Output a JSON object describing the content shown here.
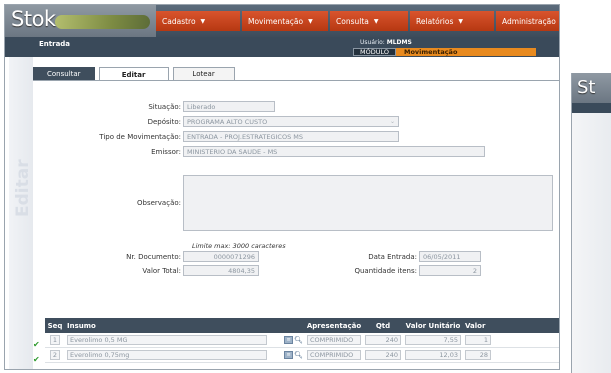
{
  "header": {
    "logo": "Stok",
    "menu": [
      "Cadastro",
      "Movimentação",
      "Consulta",
      "Relatórios",
      "Administração"
    ],
    "page_title": "Entrada",
    "user_label": "Usuário:",
    "user_name": "MLDMS",
    "modulo_label": "MÓDULO",
    "modulo_value": "Movimentação"
  },
  "watermark": "Editar",
  "tabs": [
    "Consultar",
    "Editar",
    "Lotear"
  ],
  "form": {
    "situacao_label": "Situação:",
    "situacao": "Liberado",
    "deposito_label": "Depósito:",
    "deposito": "PROGRAMA ALTO CUSTO",
    "tipo_label": "Tipo de Movimentação:",
    "tipo": "ENTRADA - PROJ.ESTRATEGICOS MS",
    "emissor_label": "Emissor:",
    "emissor": "MINISTERIO DA SAUDE - MS",
    "observacao_label": "Observação:",
    "observacao_hint": "Limite max: 3000 caracteres",
    "nr_documento_label": "Nr. Documento:",
    "nr_documento": "0000071296",
    "valor_total_label": "Valor Total:",
    "valor_total": "4804,35",
    "data_entrada_label": "Data Entrada:",
    "data_entrada": "06/05/2011",
    "quantidade_itens_label": "Quantidade itens:",
    "quantidade_itens": "2"
  },
  "grid": {
    "headers": [
      "Seq",
      "Insumo",
      "Apresentação",
      "Qtd",
      "Valor Unitário",
      "Valor"
    ],
    "rows": [
      {
        "seq": "1",
        "insumo": "Everolimo 0,5 MG",
        "apresentacao": "COMPRIMIDO",
        "qtd": "240",
        "valor_unitario": "7,55",
        "valor": "1"
      },
      {
        "seq": "2",
        "insumo": "Everolimo 0,75mg",
        "apresentacao": "COMPRIMIDO",
        "qtd": "240",
        "valor_unitario": "12,03",
        "valor": "28"
      }
    ]
  },
  "second_window": {
    "logo": "St"
  },
  "colors": {
    "menu_orange": "#c8461d",
    "header_dark": "#3f4e5d",
    "modulo_orange": "#e88a1f",
    "check_green": "#2d9a2d"
  }
}
